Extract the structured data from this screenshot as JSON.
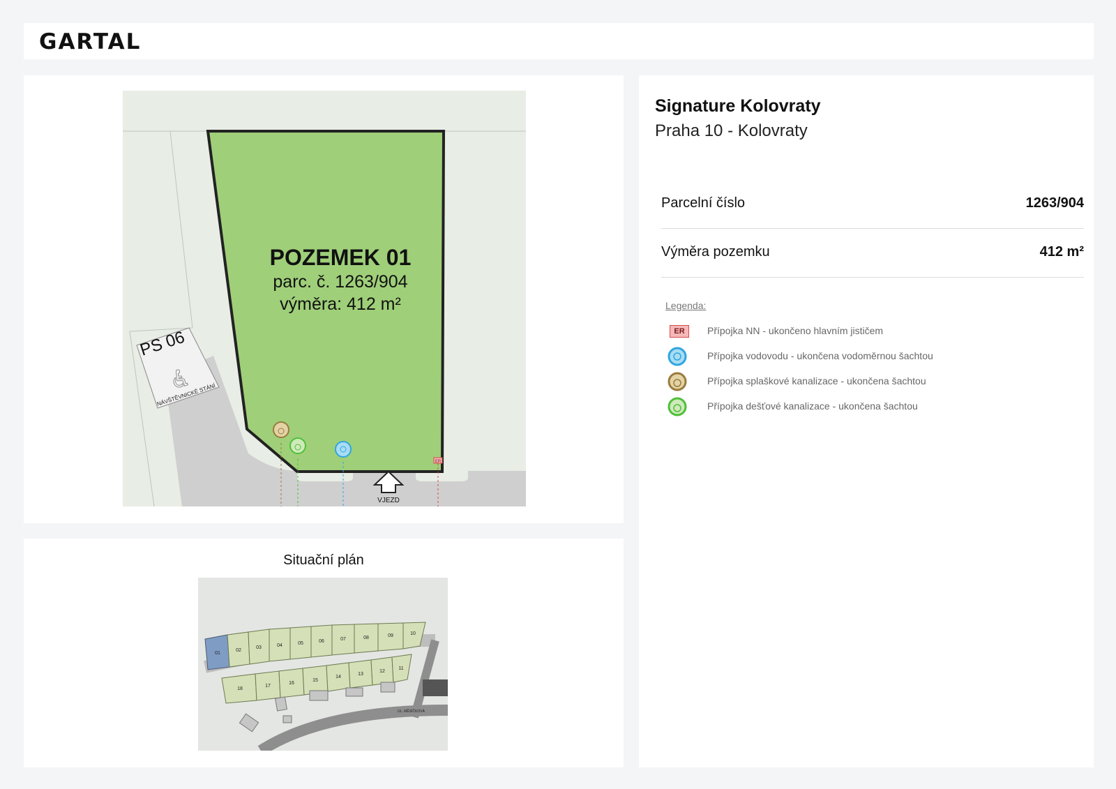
{
  "header": {
    "logo": "GARTAL"
  },
  "plot": {
    "title": "POZEMEK 01",
    "parcel_line": "parc.  č. 1263/904",
    "area_line": "výměra: 412 m²",
    "parking_label": "PS 06",
    "parking_sublabel": "NÁVŠTĚVNICKÉ STÁNÍ",
    "entry_label": "VJEZD",
    "er_marker": "ER"
  },
  "situace": {
    "title": "Situační plán",
    "top_row": [
      "01",
      "02",
      "03",
      "04",
      "05",
      "06",
      "07",
      "08",
      "09",
      "10"
    ],
    "bottom_row": [
      "18",
      "17",
      "16",
      "15",
      "14",
      "13",
      "12",
      "11"
    ],
    "street_label": "UL. MĚSÍČKOVÁ",
    "highlight_color": "#7f9cc4"
  },
  "info": {
    "project_name": "Signature Kolovraty",
    "location": "Praha 10 - Kolovraty",
    "rows": [
      {
        "label": "Parcelní číslo",
        "value": "1263/904"
      },
      {
        "label": "Výměra pozemku",
        "value": "412 m²"
      }
    ]
  },
  "legend": {
    "title": "Legenda:",
    "items": [
      {
        "icon": "er-box-icon",
        "text": "Přípojka NN - ukončeno hlavním jističem",
        "color": "#d84a4a"
      },
      {
        "icon": "water-connection-icon",
        "text": "Přípojka vodovodu - ukončena vodoměrnou šachtou",
        "color": "#2fa6e0"
      },
      {
        "icon": "sewer-connection-icon",
        "text": "Přípojka splaškové kanalizace - ukončena šachtou",
        "color": "#9a7b3c"
      },
      {
        "icon": "rain-sewer-connection-icon",
        "text": "Přípojka dešťové kanalizace - ukončena šachtou",
        "color": "#4fbf3a"
      }
    ]
  }
}
